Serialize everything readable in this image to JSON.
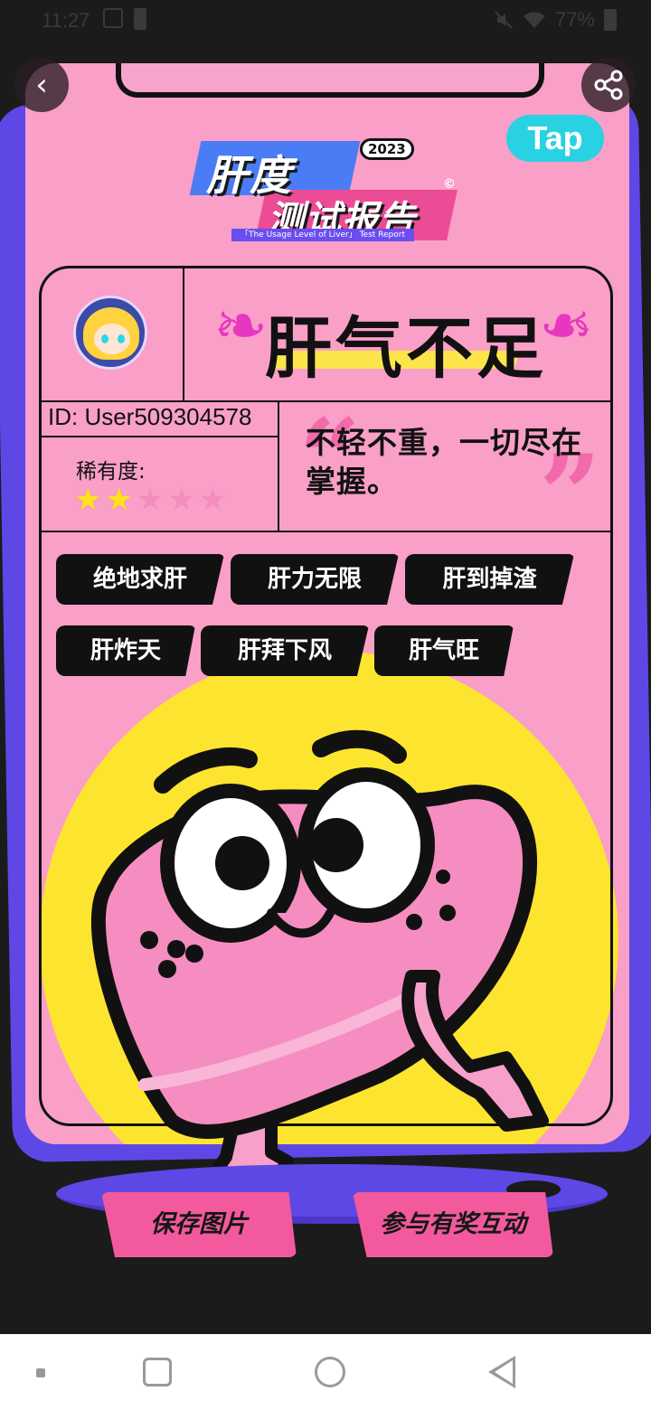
{
  "status_bar": {
    "time": "11:27",
    "battery_percent": "77%",
    "icons": [
      "dnd-off-icon",
      "battery-saver-icon",
      "mute-icon",
      "wifi-icon",
      "battery-icon"
    ]
  },
  "header": {
    "back_icon": "back-chevron-icon",
    "share_icon": "share-icon",
    "tap_logo": "Tap"
  },
  "logo": {
    "line1": "肝度",
    "line2": "测试报告",
    "year": "2023",
    "copyright": "©",
    "subtitle": "「The Usage Level of Liver」 Test Report"
  },
  "profile": {
    "user_id": "ID: User509304578",
    "rarity_label": "稀有度:",
    "rarity_stars": 2,
    "rarity_max": 5
  },
  "result": {
    "title": "肝气不足",
    "comment": "不轻不重，一切尽在掌握。"
  },
  "tags": [
    "绝地求肝",
    "肝力无限",
    "肝到掉渣",
    "肝炸天",
    "肝拜下风",
    "肝气旺"
  ],
  "actions": {
    "save_label": "保存图片",
    "join_label": "参与有奖互动"
  },
  "colors": {
    "card_pink": "#f99fc8",
    "accent_purple": "#5d48e6",
    "sun_yellow": "#fde52f",
    "button_pink": "#f25a9d",
    "tap_cyan": "#29d2e2"
  }
}
